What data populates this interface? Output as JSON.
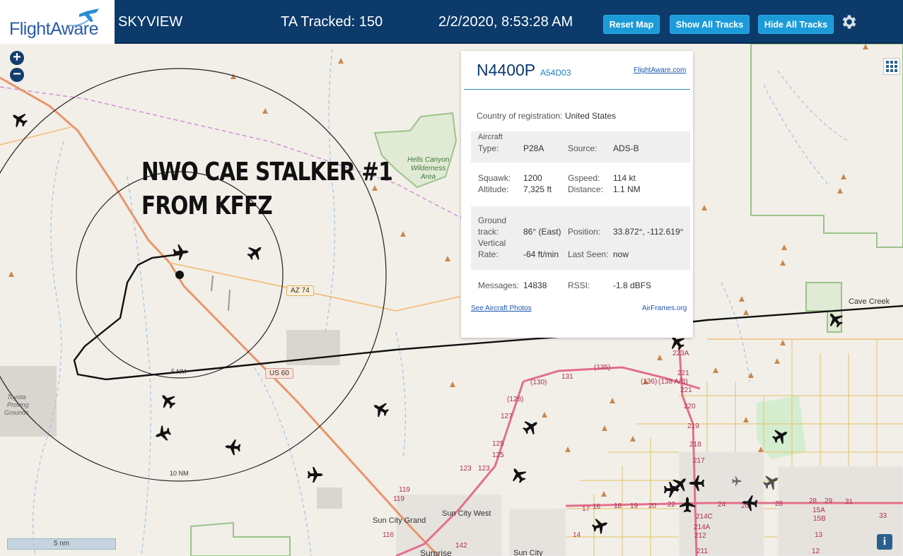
{
  "header": {
    "logo_text": "FlightAware",
    "app_name": "SKYVIEW",
    "tracked": "TA Tracked: 150",
    "datetime": "2/2/2020, 8:53:28 AM",
    "reset_map": "Reset Map",
    "show_all": "Show All Tracks",
    "hide_all": "Hide All Tracks"
  },
  "annotation": {
    "line1": "NWO CAE STALKER #1",
    "line2": "FROM KFFZ"
  },
  "popup": {
    "callsign": "N4400P",
    "hex": "A54D03",
    "fa_link": "FlightAware.com",
    "country_label": "Country of registration:",
    "country": "United States",
    "aircraft_type_label_1": "Aircraft",
    "aircraft_type_label_2": "Type:",
    "aircraft_type": "P28A",
    "source_label": "Source:",
    "source": "ADS-B",
    "squawk_label": "Squawk:",
    "squawk": "1200",
    "altitude_label": "Altitude:",
    "altitude": "7,325 ft",
    "gspeed_label": "Gspeed:",
    "gspeed": "114 kt",
    "distance_label": "Distance:",
    "distance": "1.1 NM",
    "track_label_1": "Ground",
    "track_label_2": "track:",
    "track": "86° (East)",
    "position_label": "Position:",
    "position": "33.872°, -112.619°",
    "vrate_label_1": "Vertical",
    "vrate_label_2": "Rate:",
    "vrate": "-64 ft/min",
    "lastseen_label": "Last Seen:",
    "lastseen": "now",
    "messages_label": "Messages:",
    "messages": "14838",
    "rssi_label": "RSSI:",
    "rssi": "-1.8 dBFS",
    "photos_link": "See Aircraft Photos",
    "airframes_link": "AirFrames.org"
  },
  "map": {
    "ring_5": "5 NM",
    "ring_10": "10 NM",
    "scale": "5 nm",
    "labels": {
      "hells_canyon": "Hells Canyon",
      "wilderness": "Wilderness",
      "area": "Area",
      "az74": "AZ 74",
      "us60": "US 60",
      "toyota_1": "Toyota",
      "toyota_2": "Proving",
      "toyota_3": "Grounds",
      "cave_creek": "Cave Creek",
      "sun_city_west": "Sun City West",
      "sun_city_grand": "Sun City Grand",
      "surprise": "Surprise",
      "sun_city": "Sun City",
      "r135": "(135)",
      "r130": "(130)",
      "r136": "(136)",
      "r138": "(138 A/B)",
      "r128": "(128)",
      "x131": "131",
      "x127": "127",
      "x125": "125",
      "x123": "123",
      "x119": "119",
      "x116": "116",
      "x142": "142",
      "x223a": "223A",
      "x221": "221",
      "x220": "220",
      "x219": "219",
      "x218": "218",
      "x217": "217",
      "x214c": "214C",
      "x214a": "214A",
      "x212": "212",
      "x211": "211",
      "x22": "22",
      "x24": "24",
      "x26": "26",
      "x28": "28",
      "x29": "29",
      "x31": "31",
      "x33": "33",
      "x15a": "15A",
      "x15b": "15B",
      "x13": "13",
      "x12": "12",
      "x17": "17",
      "x16": "16",
      "x18": "18",
      "x19": "19",
      "x20": "20",
      "x14": "14"
    }
  }
}
